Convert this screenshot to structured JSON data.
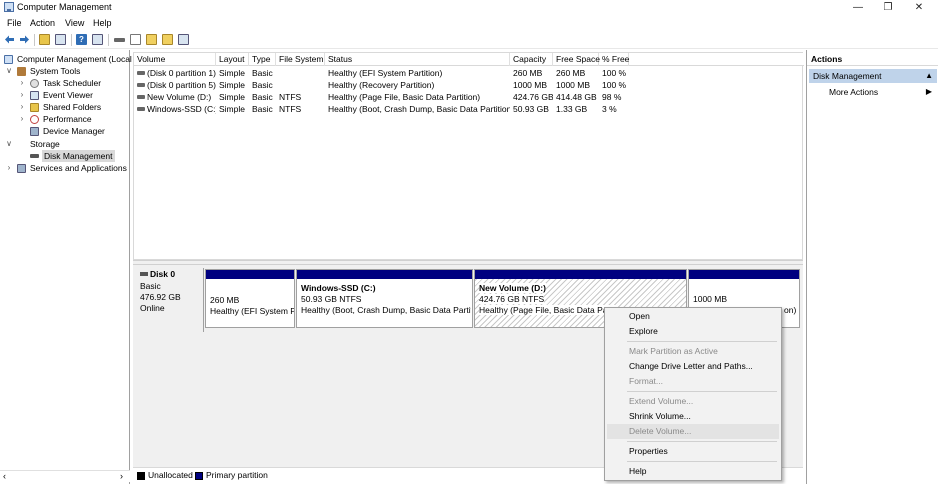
{
  "window": {
    "title": "Computer Management",
    "controls": {
      "minimize": "—",
      "restore": "❐",
      "close": "✕"
    }
  },
  "menu": [
    "File",
    "Action",
    "View",
    "Help"
  ],
  "tree": {
    "root": "Computer Management (Local",
    "items": [
      {
        "label": "System Tools",
        "caret": "∨",
        "icon": "tools-icon"
      },
      {
        "label": "Task Scheduler",
        "caret": "›",
        "icon": "task-scheduler-icon"
      },
      {
        "label": "Event Viewer",
        "caret": "›",
        "icon": "event-viewer-icon"
      },
      {
        "label": "Shared Folders",
        "caret": "›",
        "icon": "shared-folders-icon"
      },
      {
        "label": "Performance",
        "caret": "›",
        "icon": "performance-icon"
      },
      {
        "label": "Device Manager",
        "caret": "",
        "icon": "device-manager-icon"
      },
      {
        "label": "Storage",
        "caret": "∨",
        "icon": "storage-icon"
      },
      {
        "label": "Disk Management",
        "caret": "",
        "icon": "disk-management-icon"
      },
      {
        "label": "Services and Applications",
        "caret": "›",
        "icon": "services-icon"
      }
    ]
  },
  "volumes": {
    "headers": [
      "Volume",
      "Layout",
      "Type",
      "File System",
      "Status",
      "Capacity",
      "Free Space",
      "% Free"
    ],
    "rows": [
      [
        "(Disk 0 partition 1)",
        "Simple",
        "Basic",
        "",
        "Healthy (EFI System Partition)",
        "260 MB",
        "260 MB",
        "100 %"
      ],
      [
        "(Disk 0 partition 5)",
        "Simple",
        "Basic",
        "",
        "Healthy (Recovery Partition)",
        "1000 MB",
        "1000 MB",
        "100 %"
      ],
      [
        "New Volume (D:)",
        "Simple",
        "Basic",
        "NTFS",
        "Healthy (Page File, Basic Data Partition)",
        "424.76 GB",
        "414.48 GB",
        "98 %"
      ],
      [
        "Windows-SSD (C:)",
        "Simple",
        "Basic",
        "NTFS",
        "Healthy (Boot, Crash Dump, Basic Data Partition)",
        "50.93 GB",
        "1.33 GB",
        "3 %"
      ]
    ]
  },
  "disk": {
    "name": "Disk 0",
    "type": "Basic",
    "size": "476.92 GB",
    "status": "Online"
  },
  "partitions": [
    {
      "title": "",
      "size": "260 MB",
      "status": "Healthy (EFI System Pa"
    },
    {
      "title": "Windows-SSD  (C:)",
      "size": "50.93 GB NTFS",
      "status": "Healthy (Boot, Crash Dump, Basic Data Partitic"
    },
    {
      "title": "New Volume  (D:)",
      "size": "424.76 GB NTFS",
      "status": "Healthy (Page File, Basic Data Parti"
    },
    {
      "title": "",
      "size": "1000 MB",
      "status": "on)"
    }
  ],
  "legend": [
    {
      "label": "Unallocated",
      "color": "#000000"
    },
    {
      "label": "Primary partition",
      "color": "#000080"
    }
  ],
  "actions": {
    "title": "Actions",
    "section": "Disk Management",
    "more": "More Actions"
  },
  "context_menu": {
    "open": "Open",
    "explore": "Explore",
    "mark_active": "Mark Partition as Active",
    "change_letter": "Change Drive Letter and Paths...",
    "format": "Format...",
    "extend": "Extend Volume...",
    "shrink": "Shrink Volume...",
    "delete": "Delete Volume...",
    "properties": "Properties",
    "help": "Help"
  },
  "colors": {
    "primary_partition": "#000080",
    "selection": "#bfd3ea"
  }
}
